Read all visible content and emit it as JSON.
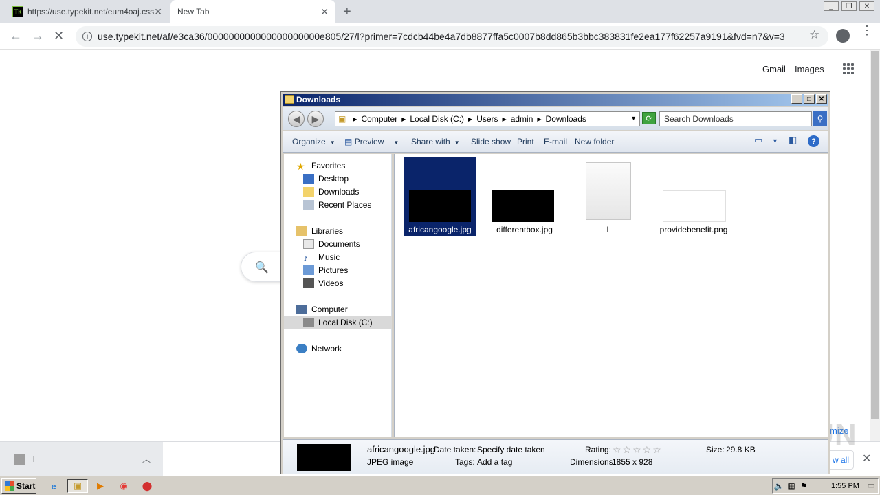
{
  "browser": {
    "tabs": [
      {
        "title": "https://use.typekit.net/eum4oaj.css",
        "favicon": "Tk"
      },
      {
        "title": "New Tab"
      }
    ],
    "url": "use.typekit.net/af/e3ca36/000000000000000000000e805/27/l?primer=7cdcb44be4a7db8877ffa5c0007b8dd865b3bbc383831fe2ea177f62257a9191&fvd=n7&v=3",
    "new_tab_symbol": "+",
    "close_symbol": "✕"
  },
  "google": {
    "gmail": "Gmail",
    "images": "Images",
    "minimize_link": "mize"
  },
  "shelf": {
    "item_name": "l",
    "show_all": "w all"
  },
  "explorer": {
    "title": "Downloads",
    "breadcrumb": [
      "Computer",
      "Local Disk (C:)",
      "Users",
      "admin",
      "Downloads"
    ],
    "search_placeholder": "Search Downloads",
    "commands": {
      "organize": "Organize",
      "preview": "Preview",
      "share_with": "Share with",
      "slide_show": "Slide show",
      "print": "Print",
      "email": "E-mail",
      "new_folder": "New folder"
    },
    "nav": {
      "favorites": "Favorites",
      "desktop": "Desktop",
      "downloads": "Downloads",
      "recent": "Recent Places",
      "libraries": "Libraries",
      "documents": "Documents",
      "music": "Music",
      "pictures": "Pictures",
      "videos": "Videos",
      "computer": "Computer",
      "local_disk": "Local Disk (C:)",
      "network": "Network"
    },
    "files": [
      {
        "name": "africangoogle.jpg"
      },
      {
        "name": "differentbox.jpg"
      },
      {
        "name": "l"
      },
      {
        "name": "providebenefit.png"
      }
    ],
    "details": {
      "name": "africangoogle.jpg",
      "type": "JPEG image",
      "date_taken_label": "Date taken:",
      "date_taken_value": "Specify date taken",
      "tags_label": "Tags:",
      "tags_value": "Add a tag",
      "rating_label": "Rating:",
      "rating_stars": "☆☆☆☆☆",
      "dimensions_label": "Dimensions:",
      "dimensions_value": "1855 x 928",
      "size_label": "Size:",
      "size_value": "29.8 KB"
    }
  },
  "taskbar": {
    "start": "Start",
    "clock": "1:55 PM"
  },
  "watermark": "ANY RUN"
}
